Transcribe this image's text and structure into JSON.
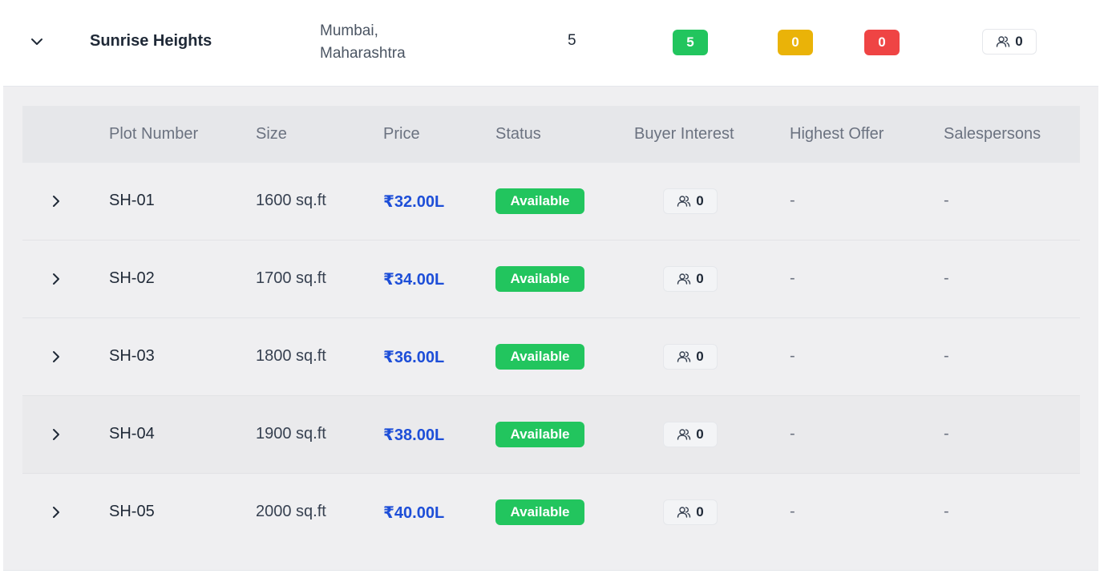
{
  "project": {
    "name": "Sunrise Heights",
    "location_line1": "Mumbai,",
    "location_line2": "Maharashtra",
    "total_plots": "5",
    "available_count": "5",
    "booked_count": "0",
    "sold_count": "0",
    "interest_count": "0",
    "expand_icon": "chevron-down-icon",
    "colors": {
      "available": "#22c55e",
      "booked": "#eab308",
      "sold": "#ef4444",
      "price": "#1d4ed8"
    }
  },
  "plots_table": {
    "headers": {
      "plot_number": "Plot Number",
      "size": "Size",
      "price": "Price",
      "status": "Status",
      "buyer_interest": "Buyer Interest",
      "highest_offer": "Highest Offer",
      "salespersons": "Salespersons"
    },
    "rows": [
      {
        "plot": "SH-01",
        "size": "1600 sq.ft",
        "price": "₹32.00L",
        "status": "Available",
        "interest": "0",
        "offer": "-",
        "sales": "-"
      },
      {
        "plot": "SH-02",
        "size": "1700 sq.ft",
        "price": "₹34.00L",
        "status": "Available",
        "interest": "0",
        "offer": "-",
        "sales": "-"
      },
      {
        "plot": "SH-03",
        "size": "1800 sq.ft",
        "price": "₹36.00L",
        "status": "Available",
        "interest": "0",
        "offer": "-",
        "sales": "-"
      },
      {
        "plot": "SH-04",
        "size": "1900 sq.ft",
        "price": "₹38.00L",
        "status": "Available",
        "interest": "0",
        "offer": "-",
        "sales": "-"
      },
      {
        "plot": "SH-05",
        "size": "2000 sq.ft",
        "price": "₹40.00L",
        "status": "Available",
        "interest": "0",
        "offer": "-",
        "sales": "-"
      }
    ]
  }
}
